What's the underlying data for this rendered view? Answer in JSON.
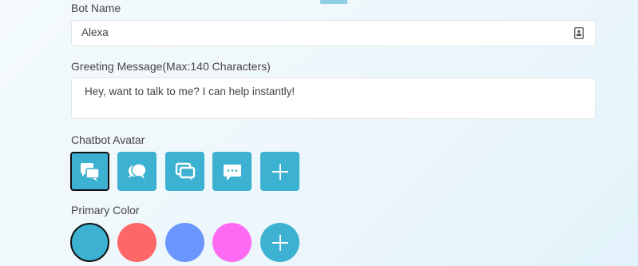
{
  "bot_name": {
    "label": "Bot Name",
    "value": "Alexa",
    "icon": "contact-card-icon"
  },
  "greeting": {
    "label": "Greeting Message(Max:140 Characters)",
    "value": "Hey, want to talk to me? I can help instantly!",
    "max_characters": 140
  },
  "avatar": {
    "label": "Chatbot Avatar",
    "selected_index": 0,
    "options": [
      {
        "icon": "chat-bubbles-icon"
      },
      {
        "icon": "speech-bubbles-icon"
      },
      {
        "icon": "stacked-chat-icon"
      },
      {
        "icon": "message-dots-icon"
      },
      {
        "icon": "plus-icon"
      }
    ],
    "accent_color": "#3cb1d1"
  },
  "primary_color": {
    "label": "Primary Color",
    "selected_index": 0,
    "swatches": [
      "#3cb1d1",
      "#fe6767",
      "#6b96fe",
      "#fd6bf3"
    ],
    "add_icon": "plus-icon"
  }
}
